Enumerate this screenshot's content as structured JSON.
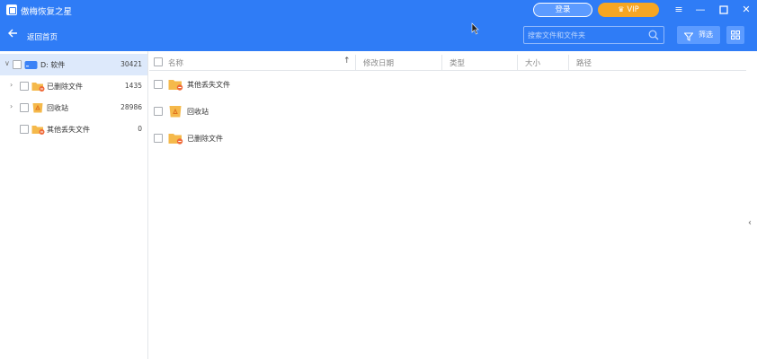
{
  "app": {
    "title": "傲梅恢复之星",
    "login_label": "登录",
    "vip_label": "VIP",
    "menu_icon": "menu-icon",
    "min_icon": "minimize-icon",
    "max_icon": "maximize-icon",
    "close_icon": "close-icon",
    "accent": "#2f7cf6",
    "vip_color": "#f6a623"
  },
  "nav": {
    "back_label": "返回首页",
    "search_placeholder": "搜索文件和文件夹",
    "filter_label": "筛选"
  },
  "tree": [
    {
      "label": "D: 软件",
      "count": "30421",
      "icon": "drive-icon",
      "expander": "∨",
      "selected": true
    },
    {
      "label": "已删除文件",
      "count": "1435",
      "icon": "folder-deleted-icon",
      "expander": "›"
    },
    {
      "label": "回收站",
      "count": "28986",
      "icon": "recycle-bin-icon",
      "expander": "›"
    },
    {
      "label": "其他丢失文件",
      "count": "0",
      "icon": "folder-lost-icon",
      "expander": ""
    }
  ],
  "columns": [
    "名称",
    "修改日期",
    "类型",
    "大小",
    "路径"
  ],
  "files": [
    {
      "name": "其他丢失文件",
      "icon": "folder-lost-icon"
    },
    {
      "name": "回收站",
      "icon": "recycle-bin-icon"
    },
    {
      "name": "已删除文件",
      "icon": "folder-deleted-icon"
    }
  ]
}
